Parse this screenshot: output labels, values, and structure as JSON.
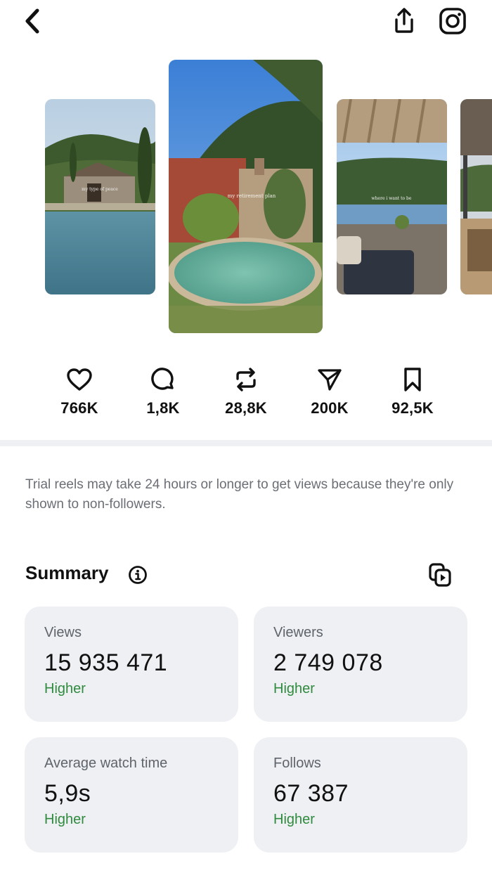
{
  "header": {
    "back_icon": "chevron-left-icon",
    "share_icon": "share-upload-icon",
    "instagram_icon": "instagram-logo-icon"
  },
  "thumbnails": [
    {
      "caption": "my type of peace"
    },
    {
      "caption": "my retirement plan"
    },
    {
      "caption": "where i want to be"
    },
    {
      "caption": ""
    }
  ],
  "engagement": [
    {
      "icon": "heart-icon",
      "value": "766K"
    },
    {
      "icon": "comment-icon",
      "value": "1,8K"
    },
    {
      "icon": "repost-icon",
      "value": "28,8K"
    },
    {
      "icon": "send-icon",
      "value": "200K"
    },
    {
      "icon": "bookmark-icon",
      "value": "92,5K"
    }
  ],
  "notice": "Trial reels may take 24 hours or longer to get views because they're only shown to non-followers.",
  "summary": {
    "title": "Summary",
    "info_icon": "info-icon",
    "action_icon": "reels-copy-icon",
    "metrics": [
      {
        "label": "Views",
        "value": "15 935 471",
        "trend": "Higher"
      },
      {
        "label": "Viewers",
        "value": "2 749 078",
        "trend": "Higher"
      },
      {
        "label": "Average watch time",
        "value": "5,9s",
        "trend": "Higher"
      },
      {
        "label": "Follows",
        "value": "67 387",
        "trend": "Higher"
      }
    ]
  },
  "colors": {
    "trend_positive": "#2f8a3e",
    "card_background": "#eff0f4",
    "muted_text": "#6b6f75"
  }
}
